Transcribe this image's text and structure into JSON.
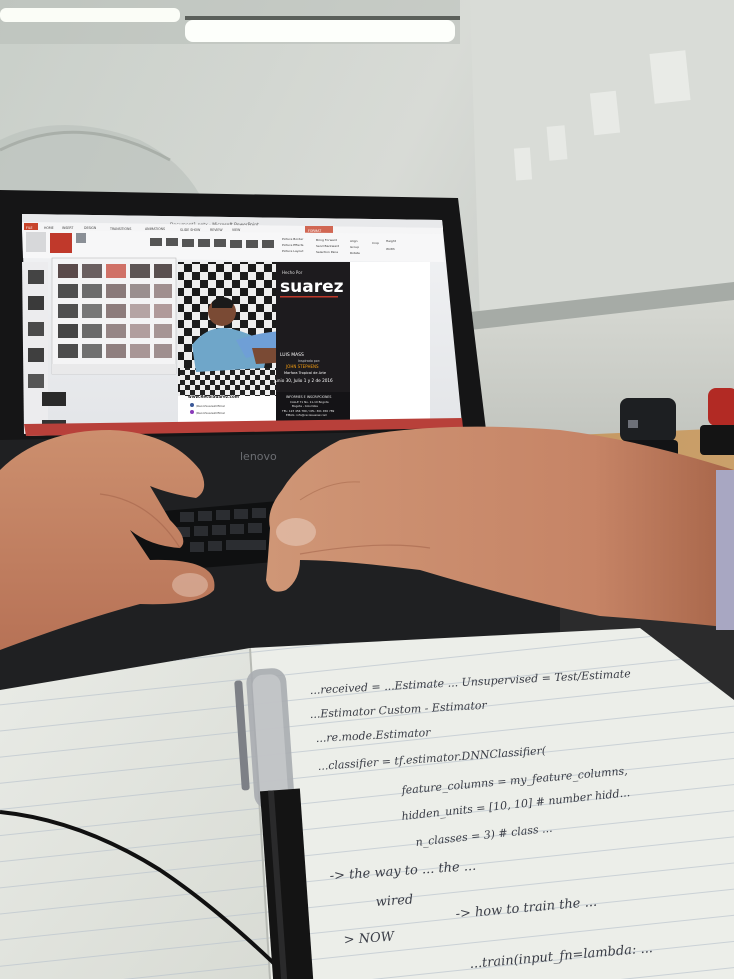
{
  "laptop": {
    "brand": "lenovo",
    "window_title": "Document1.pptx - Microsoft PowerPoint",
    "ribbon_tabs": [
      "FILE",
      "HOME",
      "INSERT",
      "DESIGN",
      "TRANSITIONS",
      "ANIMATIONS",
      "SLIDE SHOW",
      "REVIEW",
      "VIEW",
      "FORMAT"
    ],
    "ribbon_commands": [
      "Picture Border",
      "Picture Effects",
      "Picture Layout",
      "Bring Forward",
      "Send Backward",
      "Selection Pane",
      "Align",
      "Group",
      "Rotate",
      "Crop",
      "Height",
      "Width"
    ],
    "slide": {
      "brand_small": "Hecho Por",
      "brand_big": "suarez",
      "name_tag": "LUIS MASS",
      "event_lines": [
        "Inspirado por:",
        "JOHN STEPHENS",
        "Marfora Tropical de Arte",
        "Junio 30, Julio 1 y 2 de 2016"
      ],
      "contact_header": "INFORMES E INSCRIPCIONES",
      "contact_lines": [
        "CALLE 71 No. 11-10 Bogota",
        "Bogota - Colombia",
        "TEL: 123 456 789 / CEL: 301 456 789",
        "EMAIL: info@recoisuarez.com"
      ],
      "website": "www.RecoiSuarez.com",
      "social": [
        "/RecoiSuarezOficial",
        "/RecoiSuarezOficial"
      ]
    }
  },
  "notebook": {
    "handwriting_lines": [
      "...received = ...Estimate ... Unsupervised = Test/Estimate",
      "...Estimator                    Custom - Estimator",
      "...re.mode.Estimator",
      "...classifier = tf.estimator.DNNClassifier(",
      "feature_columns = my_feature_columns,",
      "hidden_units = [10, 10]  # number hidd...",
      "n_classes = 3)  # class ...",
      "-> the way to ... the ...",
      "wired",
      "-> how to train the ...",
      "> NOW",
      "...train(input_fn=lambda: ..."
    ]
  }
}
